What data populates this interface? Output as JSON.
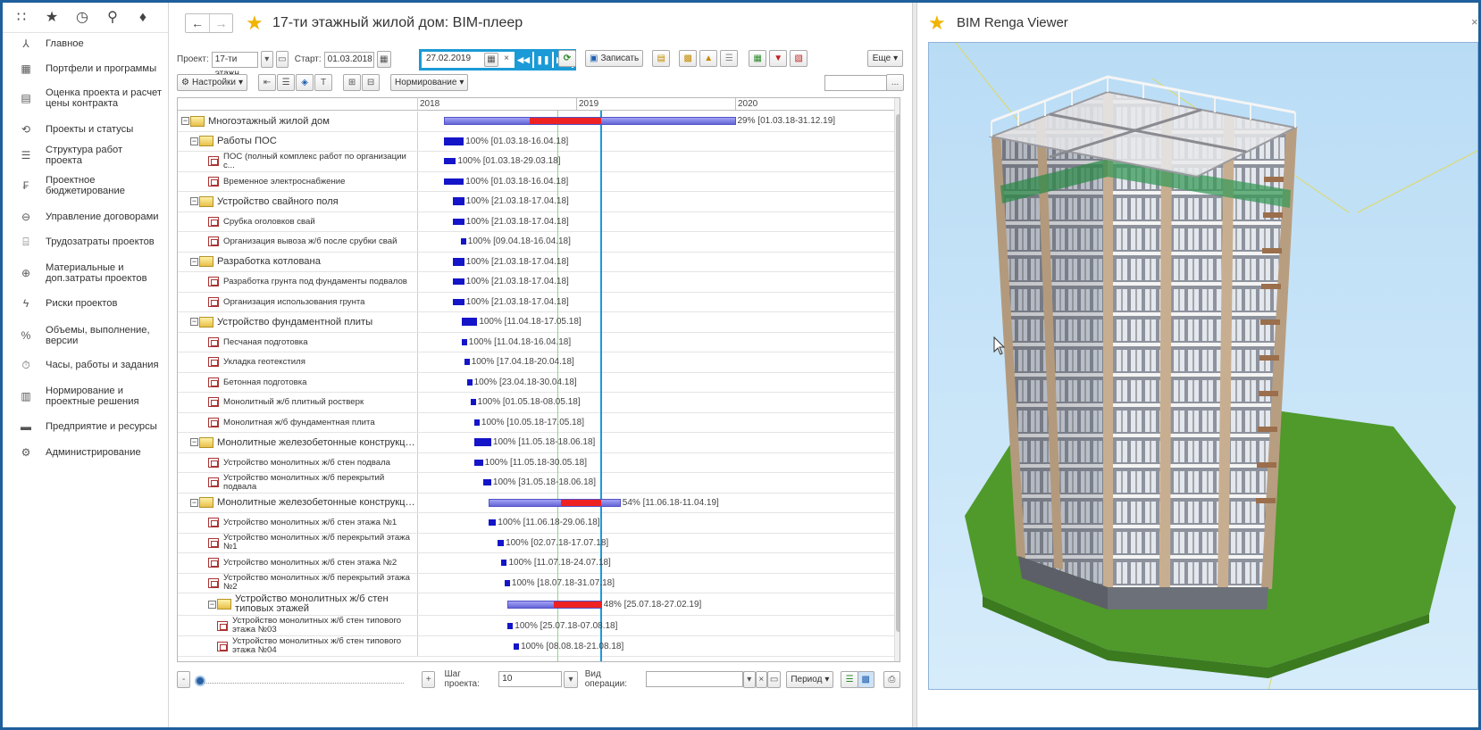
{
  "app": {
    "top_icons": [
      "apps-grid-icon",
      "star-icon",
      "history-icon",
      "search-icon",
      "bell-icon"
    ],
    "nav": [
      {
        "icon": "⅄",
        "label": "Главное"
      },
      {
        "icon": "▦",
        "label": "Портфели и программы"
      },
      {
        "icon": "▤",
        "label": "Оценка проекта и расчет цены контракта"
      },
      {
        "icon": "⟲",
        "label": "Проекты и статусы"
      },
      {
        "icon": "☰",
        "label": "Структура работ проекта"
      },
      {
        "icon": "₣",
        "label": "Проектное бюджетирование"
      },
      {
        "icon": "⊖",
        "label": "Управление договорами"
      },
      {
        "icon": "⌸",
        "label": "Трудозатраты проектов"
      },
      {
        "icon": "⊕",
        "label": "Материальные и доп.затраты проектов"
      },
      {
        "icon": "ϟ",
        "label": "Риски проектов"
      },
      {
        "icon": "%",
        "label": "Объемы, выполнение, версии"
      },
      {
        "icon": "⏱",
        "label": "Часы, работы и задания"
      },
      {
        "icon": "▥",
        "label": "Нормирование и проектные решения"
      },
      {
        "icon": "▬",
        "label": "Предприятие и ресурсы"
      },
      {
        "icon": "⚙",
        "label": "Администрирование"
      }
    ]
  },
  "main": {
    "title": "17-ти этажный жилой дом: BIM-плеер",
    "toolbar": {
      "project_label": "Проект:",
      "project_value": "17-ти этажн",
      "start_label": "Старт:",
      "start_value": "01.03.2018",
      "current_date": "27.02.2019",
      "record_label": "Записать",
      "more_label": "Еще",
      "settings_label": "Настройки",
      "norm_label": "Нормирование",
      "filter_btn": "..."
    },
    "years": [
      "2018",
      "2019",
      "2020"
    ],
    "rows": [
      {
        "level": 0,
        "type": "summary",
        "name": "Многоэтажный жилой дом",
        "pct": "29%",
        "dates": "[01.03.18-31.12.19]"
      },
      {
        "level": 1,
        "type": "summary",
        "name": "Работы ПОС",
        "pct": "100%",
        "dates": "[01.03.18-16.04.18]"
      },
      {
        "level": 2,
        "type": "task",
        "name": "ПОС (полный комплекс работ по организации с...",
        "pct": "100%",
        "dates": "[01.03.18-29.03.18]"
      },
      {
        "level": 2,
        "type": "task",
        "name": "Временное электроснабжение",
        "pct": "100%",
        "dates": "[01.03.18-16.04.18]"
      },
      {
        "level": 1,
        "type": "summary",
        "name": "Устройство свайного поля",
        "pct": "100%",
        "dates": "[21.03.18-17.04.18]"
      },
      {
        "level": 2,
        "type": "task",
        "name": "Срубка оголовков свай",
        "pct": "100%",
        "dates": "[21.03.18-17.04.18]"
      },
      {
        "level": 2,
        "type": "task",
        "name": "Организация вывоза ж/б после срубки свай",
        "pct": "100%",
        "dates": "[09.04.18-16.04.18]"
      },
      {
        "level": 1,
        "type": "summary",
        "name": "Разработка котлована",
        "pct": "100%",
        "dates": "[21.03.18-17.04.18]"
      },
      {
        "level": 2,
        "type": "task",
        "name": "Разработка грунта под фундаменты подвалов",
        "pct": "100%",
        "dates": "[21.03.18-17.04.18]"
      },
      {
        "level": 2,
        "type": "task",
        "name": "Организация использования грунта",
        "pct": "100%",
        "dates": "[21.03.18-17.04.18]"
      },
      {
        "level": 1,
        "type": "summary",
        "name": "Устройство фундаментной плиты",
        "pct": "100%",
        "dates": "[11.04.18-17.05.18]"
      },
      {
        "level": 2,
        "type": "task",
        "name": "Песчаная подготовка",
        "pct": "100%",
        "dates": "[11.04.18-16.04.18]"
      },
      {
        "level": 2,
        "type": "task",
        "name": "Укладка геотекстиля",
        "pct": "100%",
        "dates": "[17.04.18-20.04.18]"
      },
      {
        "level": 2,
        "type": "task",
        "name": "Бетонная подготовка",
        "pct": "100%",
        "dates": "[23.04.18-30.04.18]"
      },
      {
        "level": 2,
        "type": "task",
        "name": "Монолитный ж/б плитный ростверк",
        "pct": "100%",
        "dates": "[01.05.18-08.05.18]"
      },
      {
        "level": 2,
        "type": "task",
        "name": "Монолитная ж/б фундаментная плита",
        "pct": "100%",
        "dates": "[10.05.18-17.05.18]"
      },
      {
        "level": 1,
        "type": "summary",
        "name": "Монолитные железобетонные конструкци...",
        "pct": "100%",
        "dates": "[11.05.18-18.06.18]"
      },
      {
        "level": 2,
        "type": "task",
        "name": "Устройство монолитных ж/б стен подвала",
        "pct": "100%",
        "dates": "[11.05.18-30.05.18]"
      },
      {
        "level": 2,
        "type": "task",
        "name": "Устройство монолитных ж/б перекрытий подвала",
        "pct": "100%",
        "dates": "[31.05.18-18.06.18]"
      },
      {
        "level": 1,
        "type": "summary",
        "name": "Монолитные железобетонные конструкци...",
        "pct": "54%",
        "dates": "[11.06.18-11.04.19]"
      },
      {
        "level": 2,
        "type": "task",
        "name": "Устройство монолитных ж/б стен этажа №1",
        "pct": "100%",
        "dates": "[11.06.18-29.06.18]"
      },
      {
        "level": 2,
        "type": "task",
        "name": "Устройство монолитных ж/б перекрытий этажа №1",
        "pct": "100%",
        "dates": "[02.07.18-17.07.18]"
      },
      {
        "level": 2,
        "type": "task",
        "name": "Устройство монолитных ж/б стен этажа №2",
        "pct": "100%",
        "dates": "[11.07.18-24.07.18]"
      },
      {
        "level": 2,
        "type": "task",
        "name": "Устройство монолитных ж/б перекрытий этажа №2",
        "pct": "100%",
        "dates": "[18.07.18-31.07.18]"
      },
      {
        "level": 2,
        "type": "summary",
        "name": "Устройство монолитных ж/б стен типовых этажей",
        "pct": "48%",
        "dates": "[25.07.18-27.02.19]"
      },
      {
        "level": 3,
        "type": "task",
        "name": "Устройство монолитных ж/б стен типового этажа №03",
        "pct": "100%",
        "dates": "[25.07.18-07.08.18]"
      },
      {
        "level": 3,
        "type": "task",
        "name": "Устройство монолитных ж/б стен типового этажа №04",
        "pct": "100%",
        "dates": "[08.08.18-21.08.18]"
      }
    ],
    "bottom": {
      "minus": "-",
      "plus": "+",
      "step_label": "Шаг проекта:",
      "step_value": "10",
      "op_label": "Вид операции:",
      "op_value": "",
      "period_label": "Период"
    }
  },
  "viewer": {
    "title": "BIM Renga Viewer"
  }
}
